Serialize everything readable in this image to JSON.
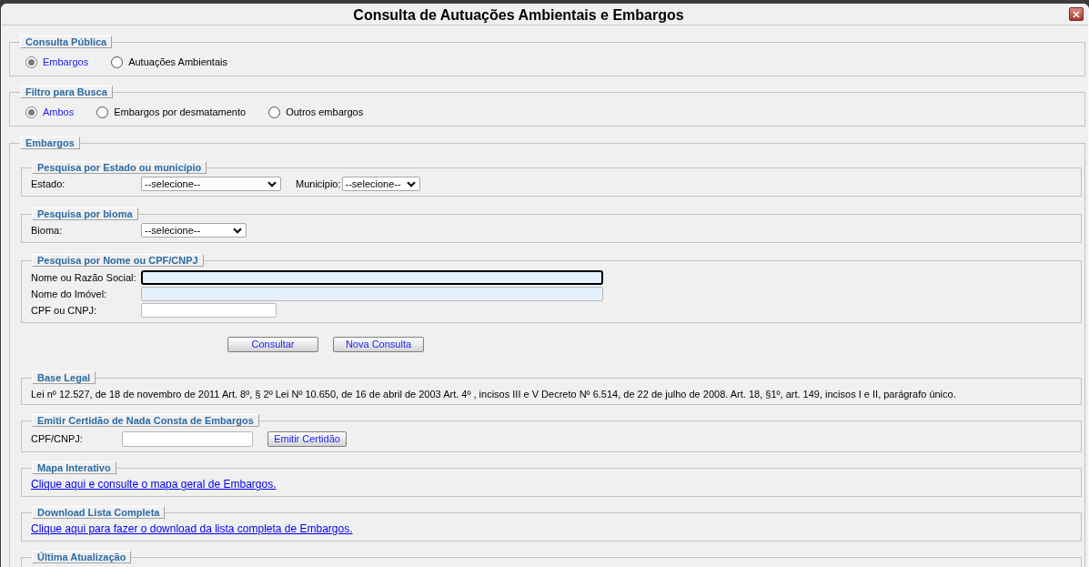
{
  "window": {
    "title": "Consulta de Autuações Ambientais e Embargos"
  },
  "consulta_publica": {
    "legend": "Consulta Pública",
    "options": [
      {
        "label": "Embargos",
        "selected": true
      },
      {
        "label": "Autuações Ambientais",
        "selected": false
      }
    ]
  },
  "filtro": {
    "legend": "Filtro para Busca",
    "options": [
      {
        "label": "Ambos",
        "selected": true
      },
      {
        "label": "Embargos por desmatamento",
        "selected": false
      },
      {
        "label": "Outros embargos",
        "selected": false
      }
    ]
  },
  "embargos": {
    "legend": "Embargos",
    "estado_municipio": {
      "legend": "Pesquisa por Estado ou município",
      "estado": {
        "label": "Estado:",
        "value": "--selecione--"
      },
      "municipio": {
        "label": "Municipio:",
        "value": "--selecione--"
      }
    },
    "bioma": {
      "legend": "Pesquisa por bioma",
      "label": "Bioma:",
      "value": "--selecione--"
    },
    "nome_cpf": {
      "legend": "Pesquisa por Nome ou CPF/CNPJ",
      "fields": [
        {
          "label": "Nome ou Razão Social:",
          "focused": true,
          "highlighted": true
        },
        {
          "label": "Nome do Imóvel:",
          "focused": false,
          "highlighted": true
        },
        {
          "label": "CPF ou CNPJ:",
          "focused": false,
          "highlighted": false
        }
      ]
    },
    "buttons": [
      "Consultar",
      "Nova Consulta"
    ],
    "base_legal": {
      "legend": "Base Legal",
      "text": "Lei nº 12.527, de 18 de novembro de 2011 Art. 8º, § 2º Lei Nº 10.650, de 16 de abril de 2003 Art. 4º , incisos III e V Decreto Nº 6.514, de 22 de julho de 2008. Art. 18, §1º, art. 149, incisos I e II, parágrafo único."
    },
    "certidao": {
      "legend": "Emitir Certidão de Nada Consta de Embargos",
      "label": "CPF/CNPJ:",
      "button": "Emitir Certidão"
    },
    "mapa": {
      "legend": "Mapa Interativo",
      "link": "Clique aqui e consulte o mapa geral de Embargos."
    },
    "download": {
      "legend": "Download Lista Completa",
      "link": "Clique aqui para fazer o download da lista completa de Embargos."
    },
    "ultima_atualizacao": {
      "legend": "Última Atualização"
    }
  }
}
